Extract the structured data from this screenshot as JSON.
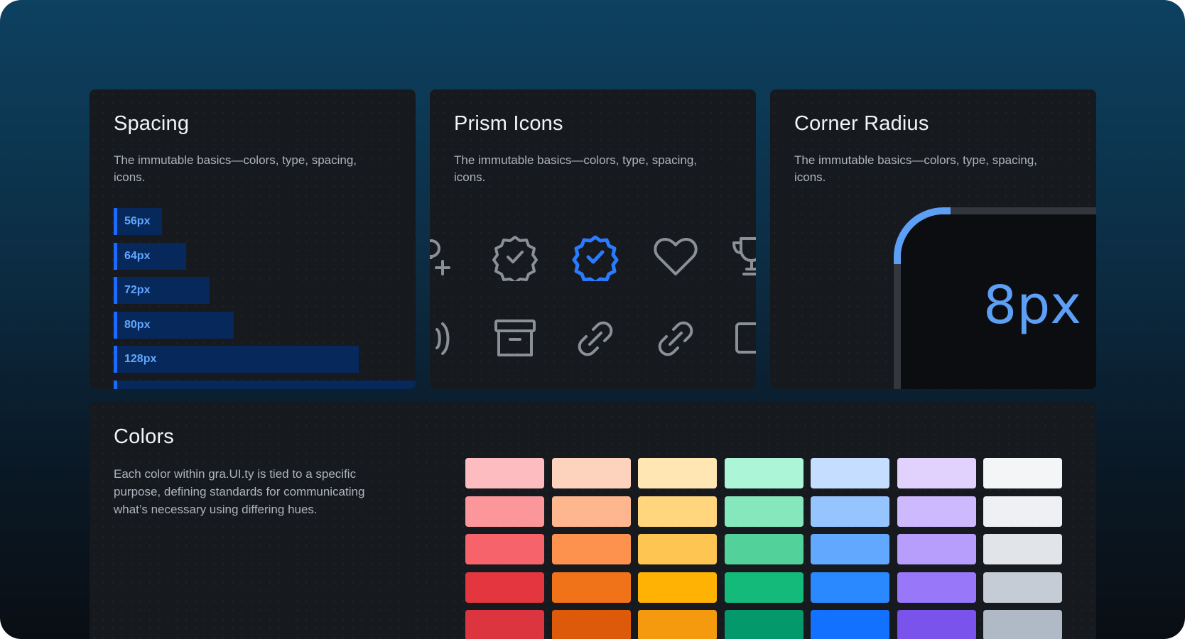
{
  "cards": {
    "spacing": {
      "title": "Spacing",
      "description": "The immutable basics—colors, type, spacing, icons.",
      "bars": [
        {
          "label": "56px",
          "value": 56
        },
        {
          "label": "64px",
          "value": 64
        },
        {
          "label": "72px",
          "value": 72
        },
        {
          "label": "80px",
          "value": 80
        },
        {
          "label": "128px",
          "value": 128
        },
        {
          "label": "",
          "value": 160
        }
      ],
      "accent_color": "#1a6bff"
    },
    "icons": {
      "title": "Prism Icons",
      "description": "The immutable basics—colors, type, spacing, icons.",
      "row1": [
        "user-add-icon",
        "verified-badge-icon",
        "verified-badge-selected-icon",
        "heart-icon",
        "trophy-icon"
      ],
      "row2": [
        "sound-icon",
        "archive-icon",
        "link-icon",
        "link-icon",
        "square-icon"
      ],
      "selected_color": "#2a7bff"
    },
    "radius": {
      "title": "Corner Radius",
      "description": "The immutable basics—colors, type, spacing, icons.",
      "value": "8px",
      "accent_color": "#5c9ff5"
    }
  },
  "colors": {
    "title": "Colors",
    "description": "Each color within gra.UI.ty is tied to a specific purpose, defining standards for communicating what’s necessary using differing hues.",
    "palette": [
      [
        "#fdbcc0",
        "#fdd3bd",
        "#ffe6b3",
        "#adf5d7",
        "#c5deff",
        "#e1d2fd",
        "#f4f5f7"
      ],
      [
        "#fb979b",
        "#feb68e",
        "#ffd67d",
        "#84e8bc",
        "#96c4ff",
        "#cdb9fd",
        "#eef0f3"
      ],
      [
        "#f6636b",
        "#fd924e",
        "#ffc553",
        "#52d19b",
        "#62a8ff",
        "#b79dfc",
        "#e1e4e9"
      ],
      [
        "#e3363f",
        "#f07219",
        "#ffb104",
        "#14ba7a",
        "#2a89ff",
        "#9877f8",
        "#c6ccd5"
      ],
      [
        "#dc3540",
        "#dd5a0b",
        "#f59a0e",
        "#03996a",
        "#1272ff",
        "#7a52ec",
        "#b0b9c6"
      ]
    ]
  }
}
